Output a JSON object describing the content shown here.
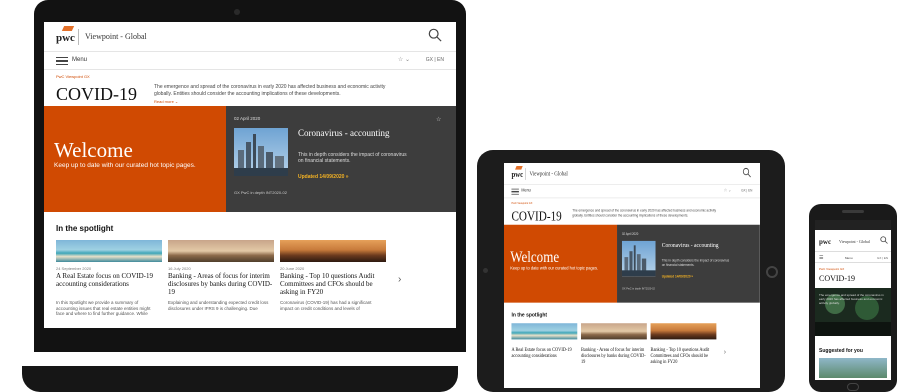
{
  "site": {
    "logo": "pwc",
    "title": "Viewpoint - Global",
    "menu_label": "Menu",
    "star_menu": "☆ ⌄",
    "lang": "GX | EN"
  },
  "page": {
    "breadcrumb": "PwC Viewpoint GX",
    "title": "COVID-19",
    "intro": "The emergence and spread of the coronavirus in early 2020 has affected business and economic activity globally. Entities should consider the accounting implications of these developments.",
    "read_more": "Read more ⌄"
  },
  "hero": {
    "welcome": "Welcome",
    "subtitle": "Keep up to date with our curated hot topic pages."
  },
  "card": {
    "date": "02 April 2020",
    "title": "Coronavirus - accounting",
    "desc": "This in depth considers the impact of coronavirus on financial statements.",
    "updated": "Updated 14/09/2020 »",
    "source": "GX PwC in depth INT2020-02"
  },
  "spotlight": {
    "heading": "In the spotlight",
    "articles": [
      {
        "date": "24 September 2020",
        "title": "A Real Estate focus on COVID-19 accounting considerations",
        "body": "In this Spotlight we provide a summary of accounting issues that real estate entities might face and where to find further guidance. While"
      },
      {
        "date": "16 July 2020",
        "title": "Banking - Areas of focus for interim disclosures by banks during COVID-19",
        "body": "Explaining and understanding expected credit loss disclosures under IFRS 9 is challenging. Due"
      },
      {
        "date": "20 June 2020",
        "title": "Banking - Top 10 questions Audit Committees and CFOs should be asking in FY20",
        "body": "Coronavirus (COVID-19) has had a significant impact on credit conditions and levels of"
      }
    ],
    "next_icon": "chevron-right-icon"
  },
  "phone": {
    "hero_text": "The emergence and spread of the coronavirus in early 2020 has affected business and economic activity globally.",
    "suggested": "Suggested for you"
  },
  "colors": {
    "accent": "#d04a02",
    "dark_card": "#3d3d3d",
    "highlight": "#f4b223"
  }
}
